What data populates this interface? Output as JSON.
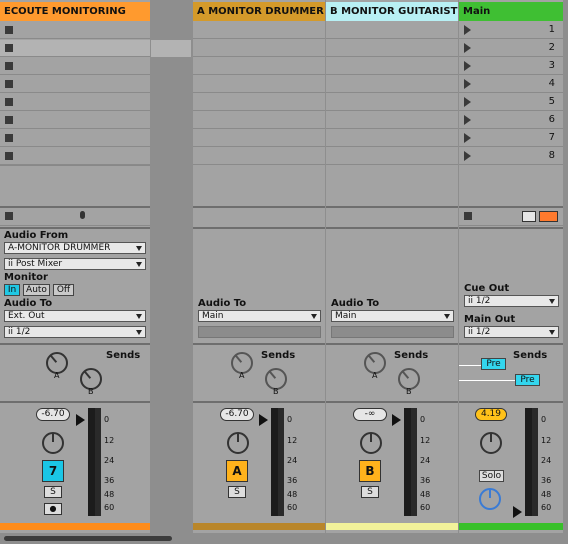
{
  "tracks": {
    "ecoute": {
      "title": "ECOUTE MONITORING",
      "color": "#ff9a2e",
      "footer_color": "#ff8c1a"
    },
    "a_monitor": {
      "title": "A MONITOR DRUMMER",
      "color": "#d49a2a",
      "footer_color": "#b9862a"
    },
    "b_monitor": {
      "title": "B MONITOR GUITARIST",
      "color": "#b8f0f4",
      "footer_color": "#f2f29a"
    },
    "main": {
      "title": "Main",
      "color": "#3fbf33",
      "footer_color": "#38c02a"
    }
  },
  "scenes": [
    "1",
    "2",
    "3",
    "4",
    "5",
    "6",
    "7",
    "8"
  ],
  "ecoute_io": {
    "audio_from_label": "Audio From",
    "audio_from_value": "A-MONITOR DRUMMER",
    "audio_from_tap": "ii Post Mixer",
    "monitor_label": "Monitor",
    "monitor_in": "In",
    "monitor_auto": "Auto",
    "monitor_off": "Off",
    "audio_to_label": "Audio To",
    "audio_to_value": "Ext. Out",
    "audio_to_channel": "ii 1/2"
  },
  "a_io": {
    "audio_to_label": "Audio To",
    "audio_to_value": "Main"
  },
  "b_io": {
    "audio_to_label": "Audio To",
    "audio_to_value": "Main"
  },
  "main_io": {
    "cue_out_label": "Cue Out",
    "cue_out_value": "ii 1/2",
    "main_out_label": "Main Out",
    "main_out_value": "ii 1/2"
  },
  "sends": {
    "label": "Sends",
    "a": "A",
    "b": "B",
    "pre": "Pre"
  },
  "mixer": {
    "ecoute": {
      "volume": "-6.70",
      "track_button": "7",
      "solo": "S",
      "arm": "●"
    },
    "a_monitor": {
      "volume": "-6.70",
      "track_button": "A",
      "solo": "S"
    },
    "b_monitor": {
      "volume": "-∞",
      "track_button": "B",
      "solo": "S"
    },
    "main": {
      "volume": "4.19",
      "solo": "Solo"
    },
    "scale": [
      "0",
      "12",
      "24",
      "36",
      "48",
      "60"
    ]
  },
  "colors": {
    "activate_track": "#1ac6e6",
    "return_track": "#ffb21c",
    "main_volume": "#ffc21a",
    "monitor_in": "#20c8e4"
  }
}
